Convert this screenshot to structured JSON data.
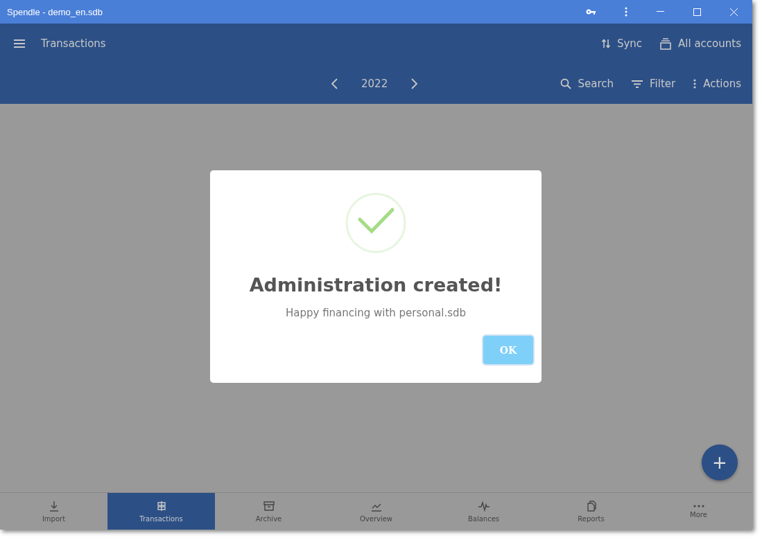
{
  "window": {
    "title": "Spendle - demo_en.sdb"
  },
  "header": {
    "title": "Transactions",
    "actions": [
      {
        "kind": "sync",
        "label": "Sync"
      },
      {
        "kind": "accounts",
        "label": "All accounts"
      }
    ]
  },
  "toolbar": {
    "period": "2022",
    "actions": [
      {
        "kind": "search",
        "label": "Search"
      },
      {
        "kind": "filter",
        "label": "Filter"
      },
      {
        "kind": "more",
        "label": "Actions"
      }
    ]
  },
  "dialog": {
    "title": "Administration created!",
    "message": "Happy financing with personal.sdb",
    "button": "OK"
  },
  "bottom_nav": [
    {
      "kind": "import",
      "label": "Import",
      "selected": false
    },
    {
      "kind": "transactions",
      "label": "Transactions",
      "selected": true
    },
    {
      "kind": "archive",
      "label": "Archive",
      "selected": false
    },
    {
      "kind": "overview",
      "label": "Overview",
      "selected": false
    },
    {
      "kind": "balances",
      "label": "Balances",
      "selected": false
    },
    {
      "kind": "reports",
      "label": "Reports",
      "selected": false
    },
    {
      "kind": "more",
      "label": "More",
      "selected": false
    }
  ],
  "fab": {
    "label": "+"
  }
}
